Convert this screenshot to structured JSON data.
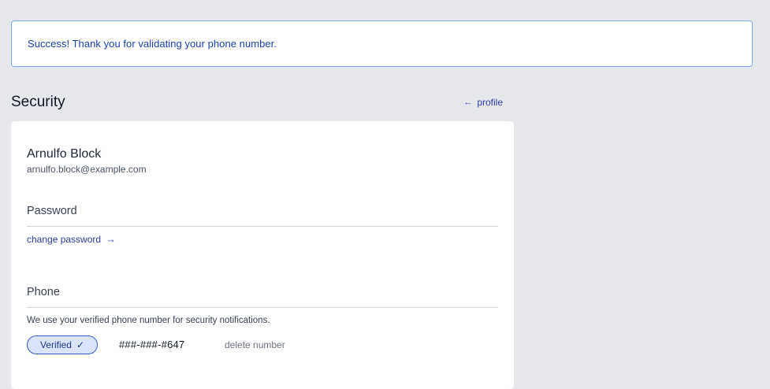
{
  "alert": {
    "message": "Success! Thank you for validating your phone number."
  },
  "header": {
    "title": "Security",
    "back_arrow": "←",
    "back_label": "profile"
  },
  "user": {
    "name": "Arnulfo Block",
    "email": "arnulfo.block@example.com"
  },
  "password_section": {
    "title": "Password",
    "change_label": "change password",
    "change_arrow": "→"
  },
  "phone_section": {
    "title": "Phone",
    "description": "We use your verified phone number for security notifications.",
    "status_label": "Verified",
    "status_icon": "checkmark-icon",
    "number": "###-###-#647",
    "delete_label": "delete number"
  },
  "colors": {
    "background": "#e5e7eb",
    "alert_border": "#7aa7e6",
    "alert_text": "#1e40af",
    "link": "#2c3aa8",
    "badge_bg": "#dbe4fb",
    "badge_border": "#3b5bcc"
  }
}
